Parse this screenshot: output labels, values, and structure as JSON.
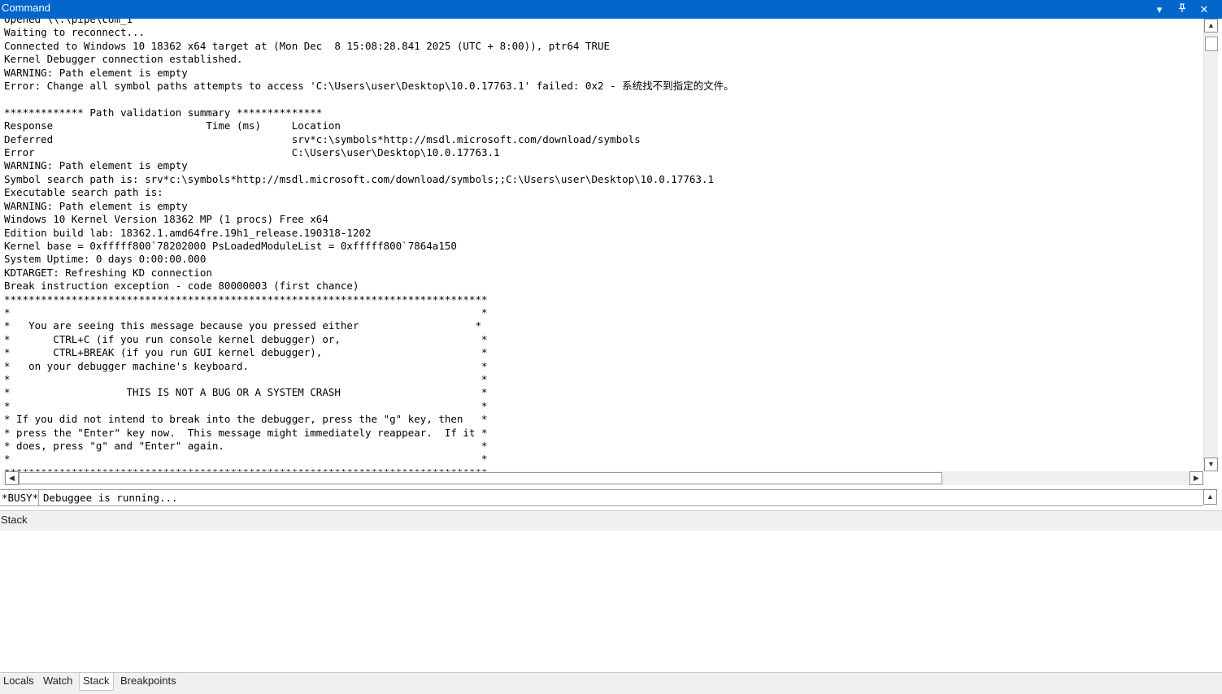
{
  "window": {
    "title": "Command",
    "buttons": {
      "dropdown": "▾",
      "pin": "📌",
      "close": "✕"
    }
  },
  "output": {
    "lines": [
      "Opened \\\\.\\pipe\\com_1",
      "Waiting to reconnect...",
      "Connected to Windows 10 18362 x64 target at (Mon Dec  8 15:08:28.841 2025 (UTC + 8:00)), ptr64 TRUE",
      "Kernel Debugger connection established.",
      "WARNING: Path element is empty",
      "Error: Change all symbol paths attempts to access 'C:\\Users\\user\\Desktop\\10.0.17763.1' failed: 0x2 - 系统找不到指定的文件。",
      "",
      "************* Path validation summary **************",
      "Response                         Time (ms)     Location",
      "Deferred                                       srv*c:\\symbols*http://msdl.microsoft.com/download/symbols",
      "Error                                          C:\\Users\\user\\Desktop\\10.0.17763.1",
      "WARNING: Path element is empty",
      "Symbol search path is: srv*c:\\symbols*http://msdl.microsoft.com/download/symbols;;C:\\Users\\user\\Desktop\\10.0.17763.1",
      "Executable search path is: ",
      "WARNING: Path element is empty",
      "Windows 10 Kernel Version 18362 MP (1 procs) Free x64",
      "Edition build lab: 18362.1.amd64fre.19h1_release.190318-1202",
      "Kernel base = 0xfffff800`78202000 PsLoadedModuleList = 0xfffff800`7864a150",
      "System Uptime: 0 days 0:00:00.000",
      "KDTARGET: Refreshing KD connection",
      "Break instruction exception - code 80000003 (first chance)",
      "*******************************************************************************",
      "*                                                                             *",
      "*   You are seeing this message because you pressed either                   *",
      "*       CTRL+C (if you run console kernel debugger) or,                       *",
      "*       CTRL+BREAK (if you run GUI kernel debugger),                          *",
      "*   on your debugger machine's keyboard.                                      *",
      "*                                                                             *",
      "*                   THIS IS NOT A BUG OR A SYSTEM CRASH                       *",
      "*                                                                             *",
      "* If you did not intend to break into the debugger, press the \"g\" key, then   *",
      "* press the \"Enter\" key now.  This message might immediately reappear.  If it *",
      "* does, press \"g\" and \"Enter\" again.                                          *",
      "*                                                                             *",
      "*******************************************************************************"
    ]
  },
  "command_line": {
    "prompt": "*BUSY*",
    "value": "Debuggee is running..."
  },
  "stack_panel": {
    "title": "Stack"
  },
  "tabs": [
    {
      "label": "Locals"
    },
    {
      "label": "Watch"
    },
    {
      "label": "Stack"
    },
    {
      "label": "Breakpoints"
    }
  ]
}
